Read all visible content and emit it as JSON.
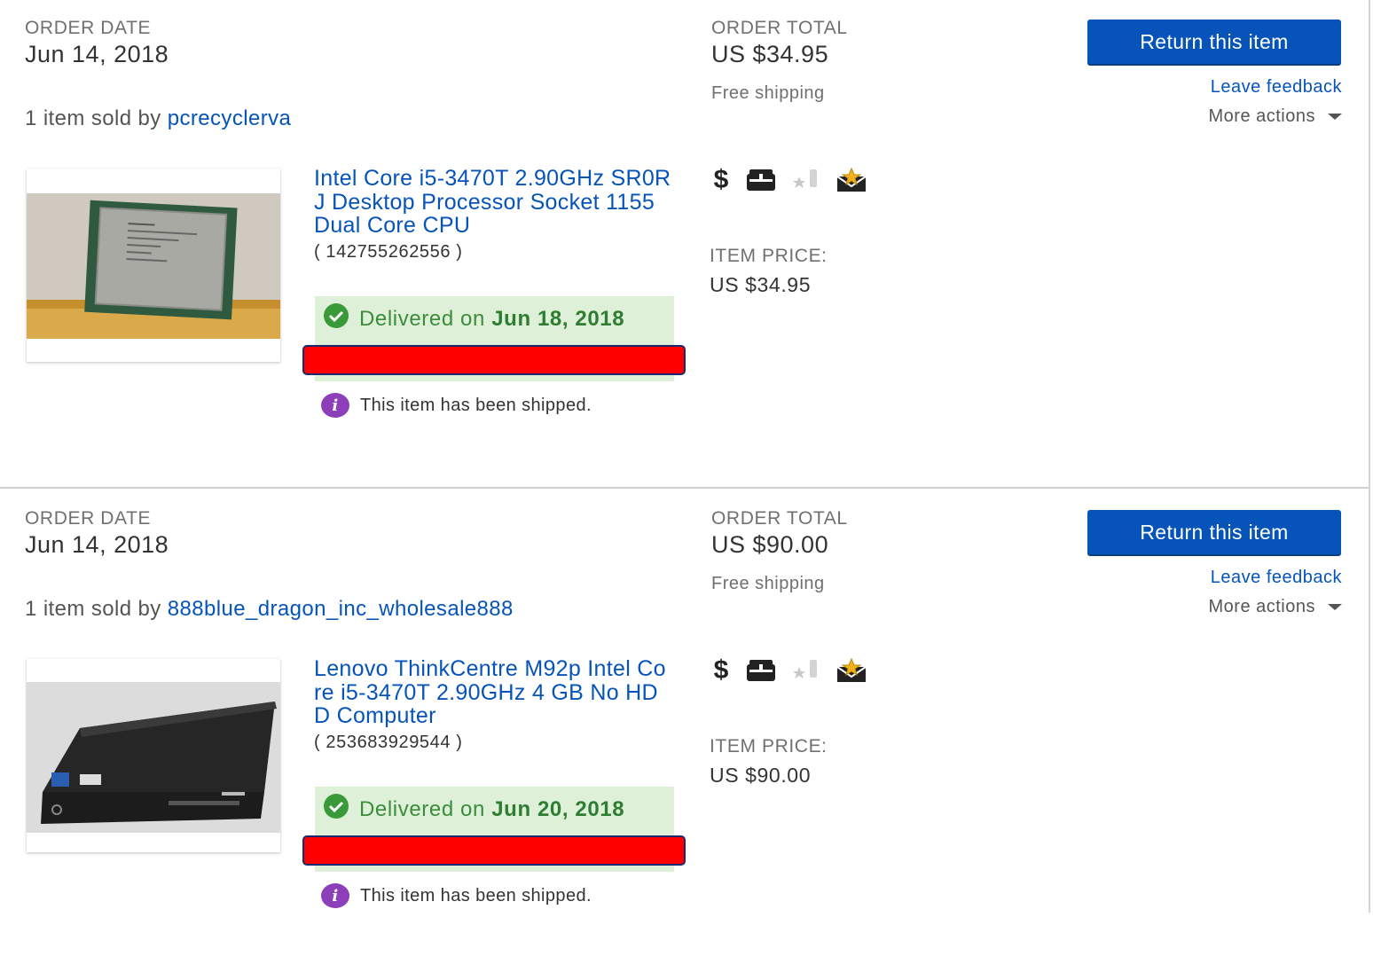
{
  "labels": {
    "order_date": "ORDER DATE",
    "order_total": "ORDER TOTAL",
    "item_price": "ITEM PRICE:",
    "sold_prefix": "1 item sold by",
    "return_button": "Return this item",
    "leave_feedback": "Leave feedback",
    "more_actions": "More actions",
    "delivered_prefix": "Delivered on",
    "shipped_message": "This item has been shipped.",
    "shipping": "Free shipping"
  },
  "orders": [
    {
      "order_date": "Jun 14, 2018",
      "order_total": "US $34.95",
      "seller": "pcrecyclerva",
      "item_title": "Intel Core i5-3470T 2.90GHz SR0RJ Desktop Processor Socket 1155 Dual Core CPU",
      "item_number": "( 142755262556 )",
      "item_price": "US $34.95",
      "delivered_date": "Jun 18, 2018",
      "image": "cpu-photo"
    },
    {
      "order_date": "Jun 14, 2018",
      "order_total": "US $90.00",
      "seller": "888blue_dragon_inc_wholesale888",
      "item_title": "Lenovo ThinkCentre M92p Intel Core i5-3470T 2.90GHz 4 GB No HDD Computer",
      "item_number": "( 253683929544 )",
      "item_price": "US $90.00",
      "delivered_date": "Jun 20, 2018",
      "image": "mini-pc-photo"
    }
  ],
  "colors": {
    "link": "#0654ba",
    "button": "#0654ba",
    "delivered_bg": "#dff0d8",
    "delivered_text": "#3b8c3b",
    "redaction": "#ff0000",
    "info_icon": "#8c3fb9"
  },
  "status_icons": [
    "dollar-icon",
    "package-icon",
    "star-feedback-icon",
    "envelope-star-icon"
  ]
}
